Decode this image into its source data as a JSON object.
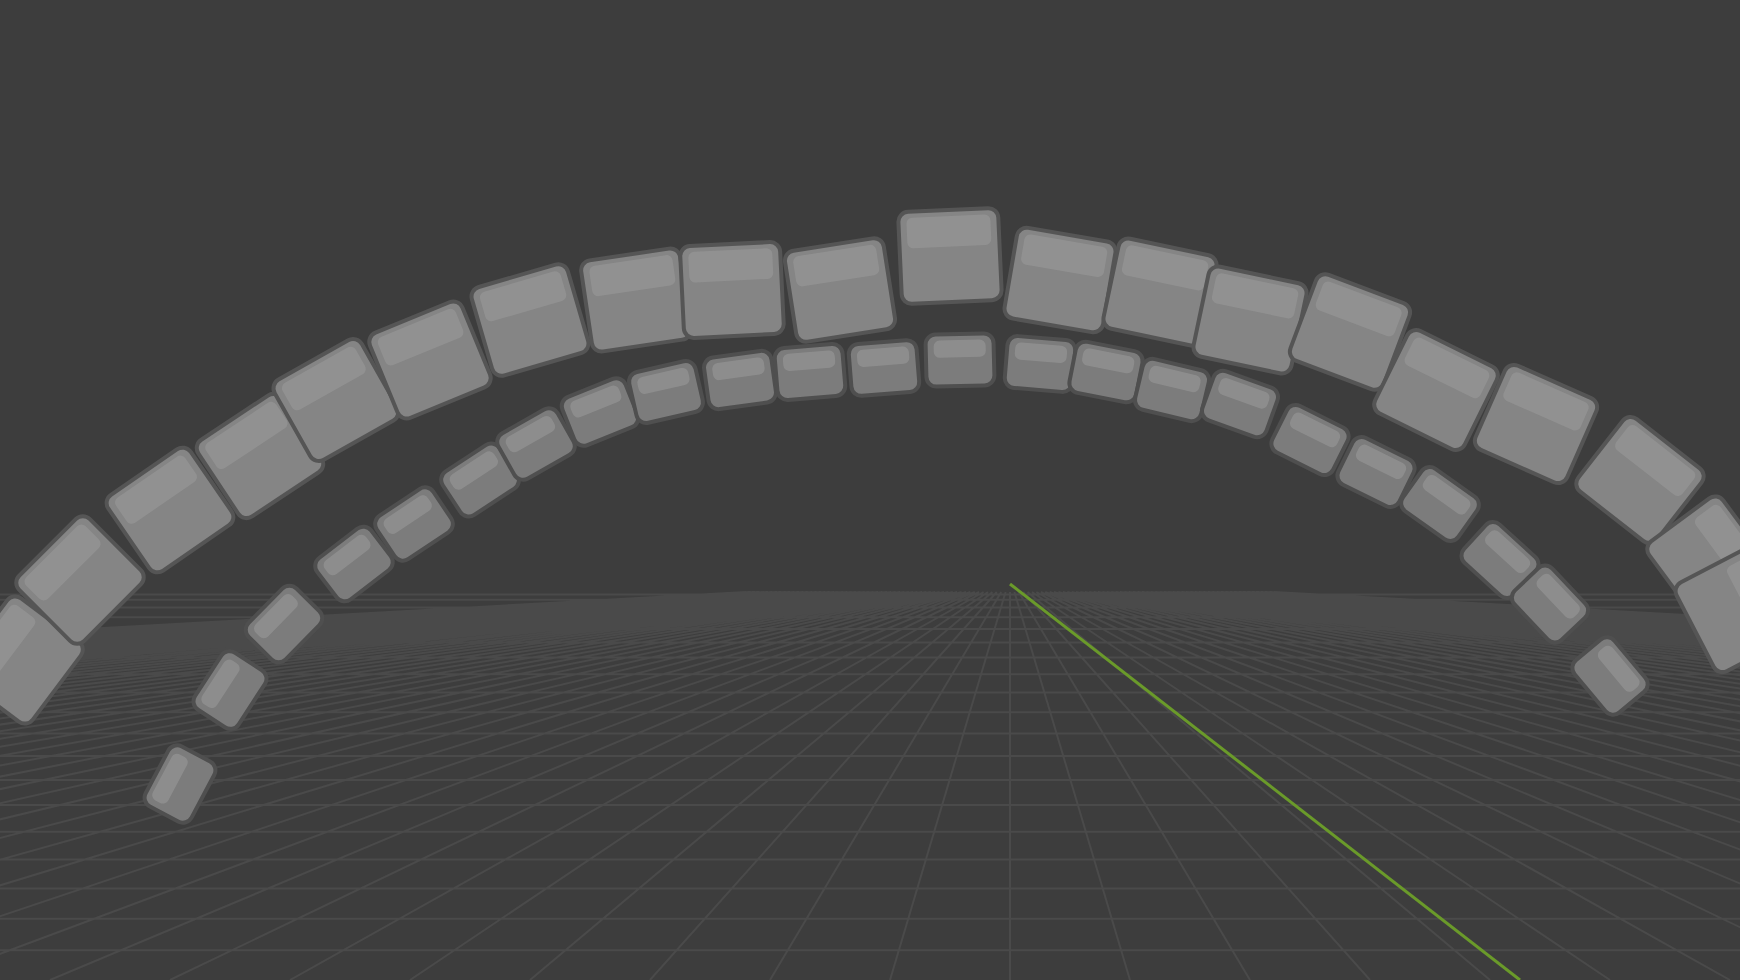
{
  "viewport": {
    "show_grid": true,
    "show_y_axis": true
  }
}
